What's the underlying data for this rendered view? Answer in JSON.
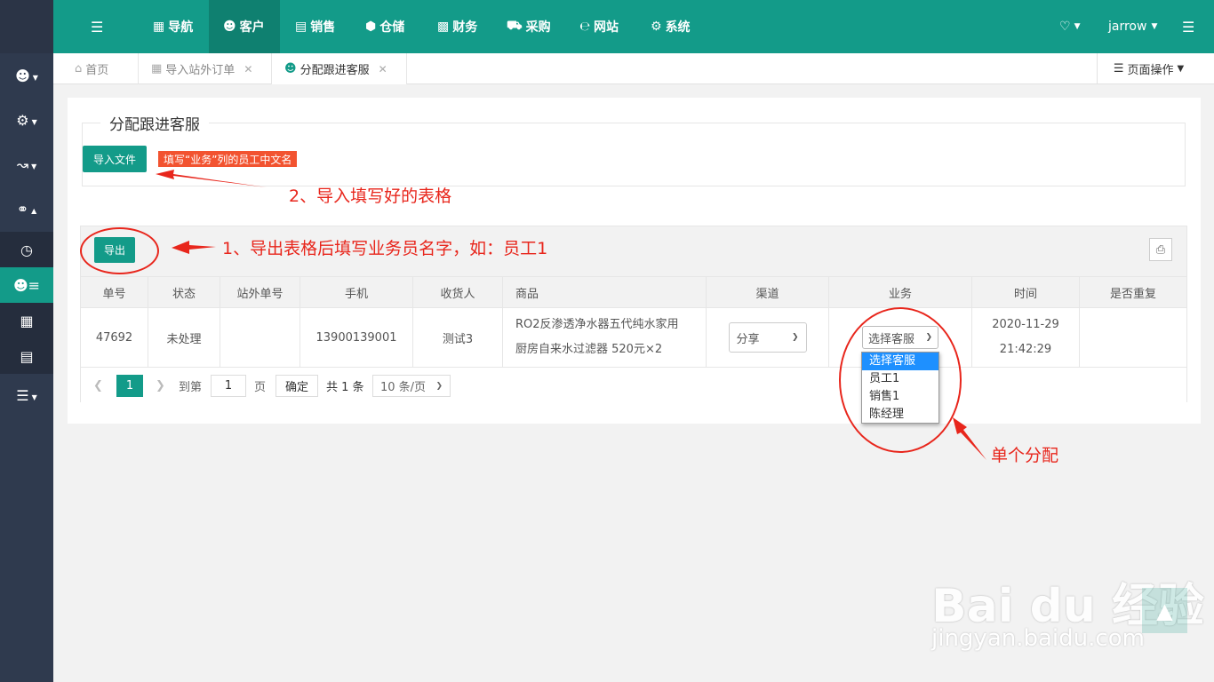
{
  "topnav": {
    "items": [
      {
        "icon": "grid-icon",
        "label": "导航"
      },
      {
        "icon": "user-icon",
        "label": "客户"
      },
      {
        "icon": "clipboard-icon",
        "label": "销售"
      },
      {
        "icon": "cube-icon",
        "label": "仓储"
      },
      {
        "icon": "ledger-icon",
        "label": "财务"
      },
      {
        "icon": "cart-icon",
        "label": "采购"
      },
      {
        "icon": "globe-e-icon",
        "label": "网站"
      },
      {
        "icon": "gear-icon",
        "label": "系统"
      }
    ],
    "user": "jarrow",
    "active_color": "#0f8070",
    "bar_color": "#139b89"
  },
  "tabs": [
    {
      "label": "首页"
    },
    {
      "label": "导入站外订单"
    },
    {
      "label": "分配跟进客服"
    }
  ],
  "page_ops": "页面操作",
  "panel": {
    "title": "分配跟进客服",
    "import_button": "导入文件",
    "import_hint": "填写“业务”列的员工中文名",
    "export_button": "导出"
  },
  "table": {
    "columns": [
      "单号",
      "状态",
      "站外单号",
      "手机",
      "收货人",
      "商品",
      "渠道",
      "业务",
      "时间",
      "是否重复"
    ],
    "rows": [
      {
        "order_no": "47692",
        "status": "未处理",
        "ext_no": "",
        "phone": "13900139001",
        "receiver": "测试3",
        "product_line1": "RO2反渗透净水器五代纯水家用",
        "product_line2": "厨房自来水过滤器 520元×2",
        "channel": "分享",
        "staff_placeholder": "选择客服",
        "time_date": "2020-11-29",
        "time_clock": "21:42:29",
        "duplicate": ""
      }
    ]
  },
  "staff_options": [
    "选择客服",
    "员工1",
    "销售1",
    "陈经理"
  ],
  "pager": {
    "current": "1",
    "goto_label": "到第",
    "goto_value": "1",
    "page_unit": "页",
    "confirm": "确定",
    "total": "共 1 条",
    "per_page": "10 条/页"
  },
  "annotations": {
    "step1": "1、导出表格后填写业务员名字，如：员工1",
    "step2": "2、导入填写好的表格",
    "single": "单个分配"
  },
  "watermark": {
    "brand": "Bai du 经验",
    "url": "jingyan.baidu.com"
  }
}
